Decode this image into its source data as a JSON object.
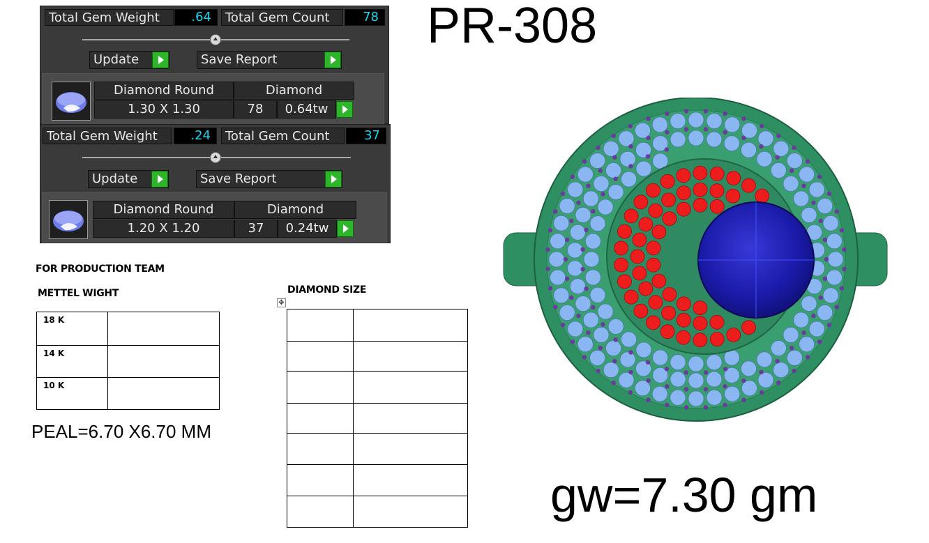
{
  "panels": [
    {
      "total_gem_weight_label": "Total Gem Weight",
      "total_gem_weight": ".64",
      "total_gem_count_label": "Total Gem Count",
      "total_gem_count": "78",
      "update_label": "Update",
      "save_report_label": "Save Report",
      "gem_shape": "Diamond Round",
      "gem_type": "Diamond",
      "gem_size": "1.30 X 1.30",
      "gem_count": "78",
      "gem_tw": "0.64tw"
    },
    {
      "total_gem_weight_label": "Total Gem Weight",
      "total_gem_weight": ".24",
      "total_gem_count_label": "Total Gem Count",
      "total_gem_count": "37",
      "update_label": "Update",
      "save_report_label": "Save Report",
      "gem_shape": "Diamond Round",
      "gem_type": "Diamond",
      "gem_size": "1.20 X 1.20",
      "gem_count": "37",
      "gem_tw": "0.24tw"
    }
  ],
  "document": {
    "production_heading": "FOR PRODUCTION TEAM",
    "metal_heading": "METTEL WIGHT",
    "metal_rows": [
      "18 K",
      "14 K",
      "10 K"
    ],
    "diamond_heading": "DIAMOND SIZE",
    "diamond_rows": 7,
    "pearl": "PEAL=6.70 X6.70 MM"
  },
  "product_code": "PR-308",
  "gross_weight": "gw=7.30 gm",
  "colors": {
    "metal": "#2e8f62",
    "diamond_blue": "#8ab6f2",
    "ruby_red": "#ee1d1d",
    "pearl_blue": "#1a1aa8",
    "prong_purple": "#6a3aa0",
    "readout_cyan": "#16d8f0",
    "button_green": "#2fb52b"
  }
}
